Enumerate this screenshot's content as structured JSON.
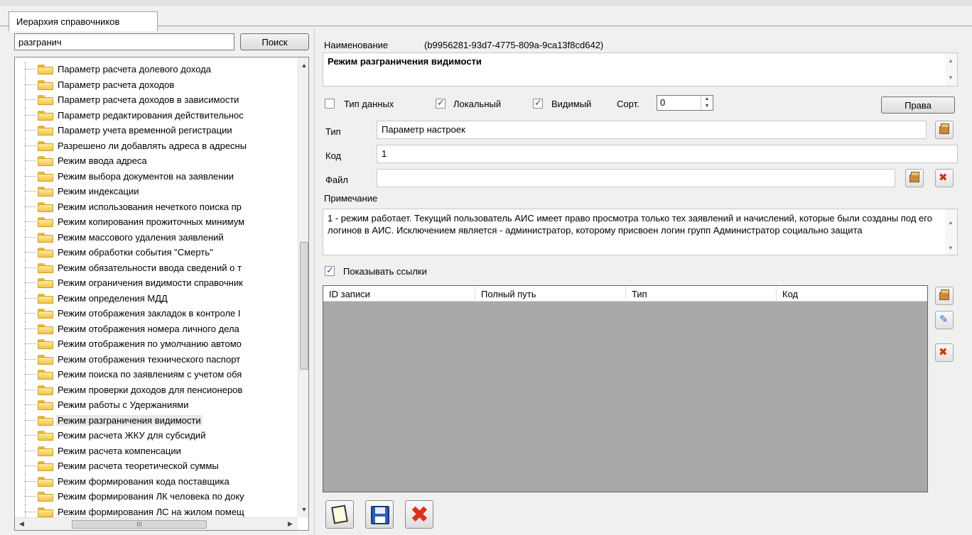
{
  "tab": {
    "label": "Иерархия справочников"
  },
  "search": {
    "value": "разгранич",
    "button": "Поиск"
  },
  "tree": {
    "items": [
      "Параметр расчета долевого дохода",
      "Параметр расчета доходов",
      "Параметр расчета доходов в зависимости",
      "Параметр редактирования действительнос",
      "Параметр учета временной регистрации",
      "Разрешено ли добавлять адреса в адресны",
      "Режим ввода адреса",
      "Режим выбора документов на заявлении",
      "Режим индексации",
      "Режим использования нечеткого поиска пр",
      "Режим копирования прожиточных минимум",
      "Режим массового удаления заявлений",
      "Режим обработки события \"Смерть\"",
      "Режим обязательности ввода сведений о т",
      "Режим ограничения видимости справочник",
      "Режим определения МДД",
      "Режим отображения закладок в контроле I",
      "Режим отображения номера личного дела",
      "Режим отображения по умолчанию автомо",
      "Режим отображения технического паспорт",
      "Режим поиска по заявлениям с учетом обя",
      "Режим проверки доходов для пенсионеров",
      "Режим работы с Удержаниями",
      "Режим разграничения видимости",
      "Режим расчета ЖКУ для субсидий",
      "Режим расчета компенсации",
      "Режим расчета теоретической суммы",
      "Режим формирования кода поставщика",
      "Режим формирования ЛК человека по доку",
      "Режим формирования ЛС на жилом помещ"
    ],
    "selected": "Режим разграничения видимости",
    "hscroll_glyph": "III"
  },
  "details": {
    "name_label": "Наименование",
    "guid": "(b9956281-93d7-4775-809a-9ca13f8cd642)",
    "name_value": "Режим разграничения видимости",
    "data_type_label": "Тип данных",
    "data_type_checked": false,
    "local_label": "Локальный",
    "local_checked": true,
    "visible_label": "Видимый",
    "visible_checked": true,
    "sort_label": "Сорт.",
    "sort_value": "0",
    "rights_button": "Права",
    "type_label": "Тип",
    "type_value": "Параметр настроек",
    "code_label": "Код",
    "code_value": "1",
    "file_label": "Файл",
    "file_value": "",
    "note_label": "Примечание",
    "note_value": "1 - режим работает. Текущий пользователь АИС имеет право просмотра только тех заявлений и начислений, которые были созданы под его логинов в АИС. Исключением является - администратор, которому присвоен логин групп Администратор социально защита",
    "show_links_label": "Показывать ссылки",
    "show_links_checked": true
  },
  "grid": {
    "columns": [
      "ID записи",
      "Полный путь",
      "Тип",
      "Код"
    ],
    "rows": []
  }
}
